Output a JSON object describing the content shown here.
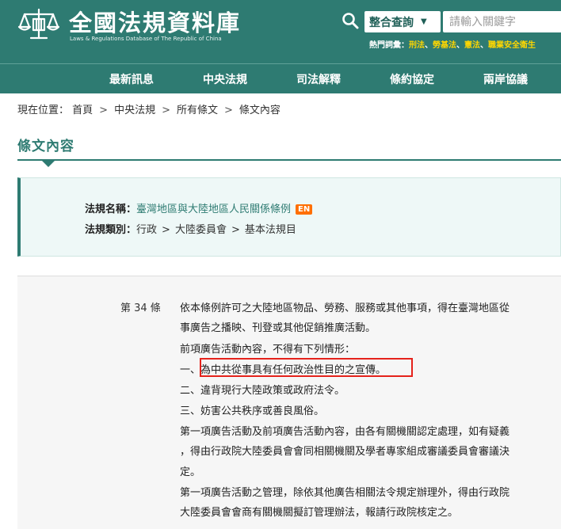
{
  "header": {
    "logo_title": "全國法規資料庫",
    "logo_subtitle": "Laws & Regulations Database of The Republic of China",
    "search_scope": "整合查詢",
    "search_placeholder": "請輸入關鍵字",
    "hot_label": "熱門詞彙：",
    "hot_terms": [
      "刑法",
      "勞基法",
      "憲法",
      "職業安全衛生"
    ]
  },
  "nav": {
    "items": [
      "最新訊息",
      "中央法規",
      "司法解釋",
      "條約協定",
      "兩岸協議"
    ]
  },
  "breadcrumb": {
    "prefix": "現在位置：",
    "items": [
      "首頁",
      "中央法規",
      "所有條文",
      "條文內容"
    ]
  },
  "section_title": "條文內容",
  "law_info": {
    "name_label": "法規名稱：",
    "name": "臺灣地區與大陸地區人民關係條例",
    "en_badge": "EN",
    "category_label": "法規類別：",
    "category": [
      "行政",
      "大陸委員會",
      "基本法規目"
    ]
  },
  "article": {
    "number": "第 34 條",
    "lines": [
      "依本條例許可之大陸地區物品、勞務、服務或其他事項，得在臺灣地區從",
      "事廣告之播映、刊登或其他促銷推廣活動。",
      "前項廣告活動內容，不得有下列情形：",
      "一、為中共從事具有任何政治性目的之宣傳。",
      "二、違背現行大陸政策或政府法令。",
      "三、妨害公共秩序或善良風俗。",
      "第一項廣告活動及前項廣告活動內容，由各有關機關認定處理，如有疑義",
      "，得由行政院大陸委員會會同相關機關及學者專家組成審議委員會審議決",
      "定。",
      "第一項廣告活動之管理，除依其他廣告相關法令規定辦理外，得由行政院",
      "大陸委員會會商有關機關擬訂管理辦法，報請行政院核定之。"
    ]
  },
  "colors": {
    "brand": "#2e7b72",
    "hot_term": "#ffd700",
    "en_badge": "#ff6f00",
    "highlight": "#e5221b"
  }
}
